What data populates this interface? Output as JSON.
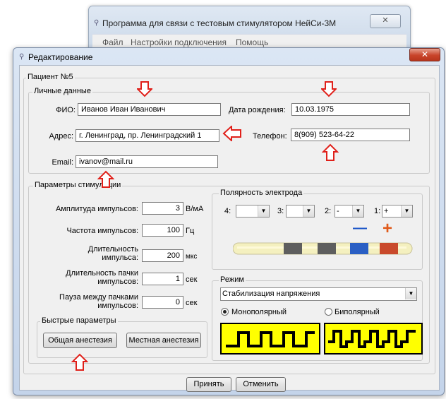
{
  "bg_window": {
    "title": "Программа для связи с тестовым стимулятором НейСи-3М",
    "close_label": "✕",
    "menu": [
      "Файл",
      "Настройки подключения",
      "Помощь"
    ]
  },
  "dialog": {
    "title": "Редактирование",
    "close_label": "✕",
    "patient_group": "Пациент №5",
    "personal": {
      "label": "Личные данные",
      "fio_label": "ФИО:",
      "fio": "Иванов Иван Иванович",
      "birth_label": "Дата рождения:",
      "birth": "10.03.1975",
      "address_label": "Адрес:",
      "address": "г. Ленинград, пр. Ленинградский 1",
      "phone_label": "Телефон:",
      "phone": "8(909) 523-64-22",
      "email_label": "Email:",
      "email": "ivanov@mail.ru"
    },
    "stim": {
      "label": "Параметры стимуляции",
      "amplitude_label": "Амплитуда импульсов:",
      "amplitude": "3",
      "amplitude_unit": "В/мА",
      "frequency_label": "Частота импульсов:",
      "frequency": "100",
      "frequency_unit": "Гц",
      "duration_label_1": "Длительность",
      "duration_label_2": "импульса:",
      "duration": "200",
      "duration_unit": "мкс",
      "burst_label_1": "Длительность пачки",
      "burst_label_2": "импульсов:",
      "burst": "1",
      "burst_unit": "сек",
      "pause_label_1": "Пауза между пачками",
      "pause_label_2": "импульсов:",
      "pause": "0",
      "pause_unit": "сек"
    },
    "quick": {
      "label": "Быстрые параметры",
      "general": "Общая анестезия",
      "local": "Местная анестезия"
    },
    "polarity": {
      "label": "Полярность электрода",
      "contacts": [
        {
          "label": "4:",
          "value": ""
        },
        {
          "label": "3:",
          "value": ""
        },
        {
          "label": "2:",
          "value": "-"
        },
        {
          "label": "1:",
          "value": "+"
        }
      ],
      "minus_sign": "—",
      "plus_sign": "+"
    },
    "mode": {
      "label": "Режим",
      "selected": "Стабилизация напряжения",
      "mono": "Монополярный",
      "bi": "Биполярный",
      "selected_radio": "mono"
    },
    "accept": "Принять",
    "cancel": "Отменить"
  },
  "colors": {
    "arrow": "#e0201a",
    "minus": "#1a55c8",
    "plus": "#e05a1a",
    "wave_bg": "#ffff00",
    "electrode": "#f4f0bf"
  }
}
